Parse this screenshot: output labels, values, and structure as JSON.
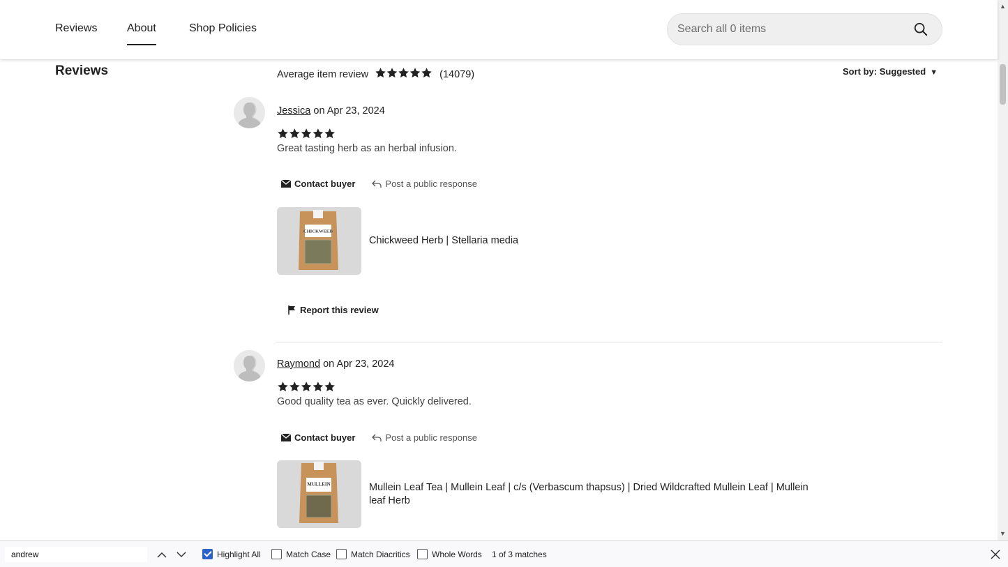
{
  "nav": {
    "tabs": [
      {
        "label": "Reviews"
      },
      {
        "label": "About"
      },
      {
        "label": "Shop Policies"
      }
    ],
    "active_tab": "About",
    "search_placeholder": "Search all 0 items"
  },
  "section_title": "Reviews",
  "average": {
    "label": "Average item review",
    "rating": 5,
    "count": "(14079)"
  },
  "sort_label": "Sort by: Suggested",
  "reviews": [
    {
      "name": "Jessica",
      "date": "on Apr 23, 2024",
      "rating": 5,
      "text": "Great tasting herb as an herbal infusion.",
      "contact_label": "Contact buyer",
      "public_label": "Post a public response",
      "listing_title": "Chickweed Herb | Stellaria media",
      "thumb_label": "CHICKWEED",
      "report_label": "Report this review"
    },
    {
      "name": "Raymond",
      "date": "on Apr 23, 2024",
      "rating": 5,
      "text": "Good quality tea as ever. Quickly delivered.",
      "contact_label": "Contact buyer",
      "public_label": "Post a public response",
      "listing_title": "Mullein Leaf Tea | Mullein Leaf | c/s (Verbascum thapsus) | Dried Wildcrafted Mullein Leaf | Mullein leaf Herb",
      "thumb_label": "MULLEIN"
    }
  ],
  "findbar": {
    "query": "andrew",
    "highlight_all": "Highlight All",
    "match_case": "Match Case",
    "match_diacritics": "Match Diacritics",
    "whole_words": "Whole Words",
    "highlight_all_checked": true,
    "match_case_checked": false,
    "match_diacritics_checked": false,
    "whole_words_checked": false,
    "matches": "1 of 3 matches"
  },
  "colors": {
    "accent_checkbox": "#2b62c9",
    "star": "#222222",
    "thumb_bag": "#c8935a"
  }
}
